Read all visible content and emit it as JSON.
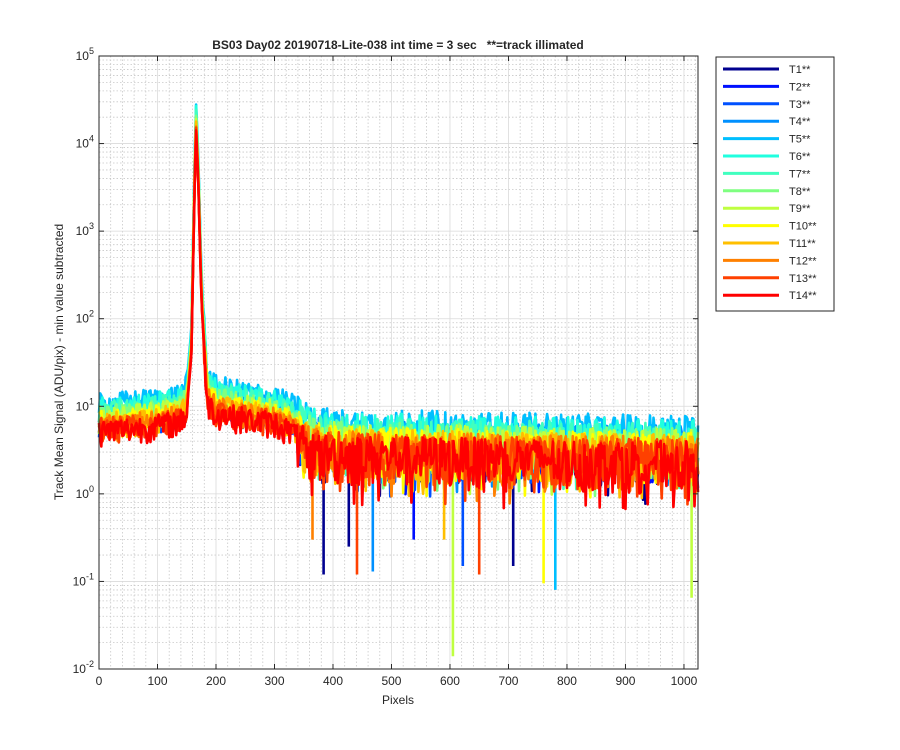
{
  "chart_data": {
    "type": "line",
    "title": "BS03 Day02 20190718-Lite-038 int time = 3 sec   **=track illimated",
    "xlabel": "Pixels",
    "ylabel": "Track Mean Signal (ADU/pix) - min value subtracted",
    "xlim": [
      0,
      1024
    ],
    "ylim": [
      0.01,
      100000
    ],
    "yscale": "log",
    "grid": true,
    "minor_grid": true,
    "legend_position": "outside-top-right",
    "x_ticks": [
      "0",
      "100",
      "200",
      "300",
      "400",
      "500",
      "600",
      "700",
      "800",
      "900",
      "1000"
    ],
    "y_tick_mantissa": "10",
    "y_tick_exponents": [
      "-2",
      "-1",
      "0",
      "1",
      "2",
      "3",
      "4",
      "5"
    ],
    "profile": {
      "x": [
        0,
        50,
        100,
        140,
        150,
        158,
        163,
        166,
        170,
        175,
        185,
        200,
        250,
        300,
        330,
        350,
        380,
        450,
        550,
        650,
        750,
        850,
        950,
        1024
      ],
      "y": [
        6.5,
        7.0,
        7.5,
        8.5,
        11,
        50,
        3000,
        18000,
        4000,
        200,
        14,
        10.5,
        9.0,
        8.0,
        6.5,
        4.5,
        3.8,
        3.6,
        3.5,
        3.4,
        3.3,
        3.2,
        3.2,
        3.1
      ]
    },
    "dips": [
      {
        "series": "T1**",
        "x": 384,
        "y": 0.12
      },
      {
        "series": "T13**",
        "x": 441,
        "y": 0.12
      },
      {
        "series": "T1**",
        "x": 427,
        "y": 0.25
      },
      {
        "series": "T4**",
        "x": 468,
        "y": 0.13
      },
      {
        "series": "T9**",
        "x": 605,
        "y": 0.014
      },
      {
        "series": "T11**",
        "x": 590,
        "y": 0.3
      },
      {
        "series": "T13**",
        "x": 650,
        "y": 0.12
      },
      {
        "series": "T3**",
        "x": 622,
        "y": 0.15
      },
      {
        "series": "T1**",
        "x": 708,
        "y": 0.15
      },
      {
        "series": "T10**",
        "x": 760,
        "y": 0.095
      },
      {
        "series": "T5**",
        "x": 780,
        "y": 0.08
      },
      {
        "series": "T9**",
        "x": 1013,
        "y": 0.065
      },
      {
        "series": "T12**",
        "x": 365,
        "y": 0.3
      },
      {
        "series": "T2**",
        "x": 538,
        "y": 0.3
      }
    ],
    "series": [
      {
        "name": "T1**",
        "color": "#00008f",
        "offset": 0.95
      },
      {
        "name": "T2**",
        "color": "#0010ff",
        "offset": 1.05
      },
      {
        "name": "T3**",
        "color": "#0050ff",
        "offset": 1.0
      },
      {
        "name": "T4**",
        "color": "#0090ff",
        "offset": 1.2
      },
      {
        "name": "T5**",
        "color": "#00bfff",
        "offset": 1.6
      },
      {
        "name": "T6**",
        "color": "#20ffdf",
        "offset": 1.45
      },
      {
        "name": "T7**",
        "color": "#40ffbf",
        "offset": 1.3
      },
      {
        "name": "T8**",
        "color": "#7fff80",
        "offset": 1.15
      },
      {
        "name": "T9**",
        "color": "#bfff40",
        "offset": 1.1
      },
      {
        "name": "T10**",
        "color": "#ffff00",
        "offset": 1.0
      },
      {
        "name": "T11**",
        "color": "#ffbf00",
        "offset": 0.95
      },
      {
        "name": "T12**",
        "color": "#ff8000",
        "offset": 0.9
      },
      {
        "name": "T13**",
        "color": "#ff4000",
        "offset": 0.85
      },
      {
        "name": "T14**",
        "color": "#ff0000",
        "offset": 0.8
      }
    ]
  }
}
